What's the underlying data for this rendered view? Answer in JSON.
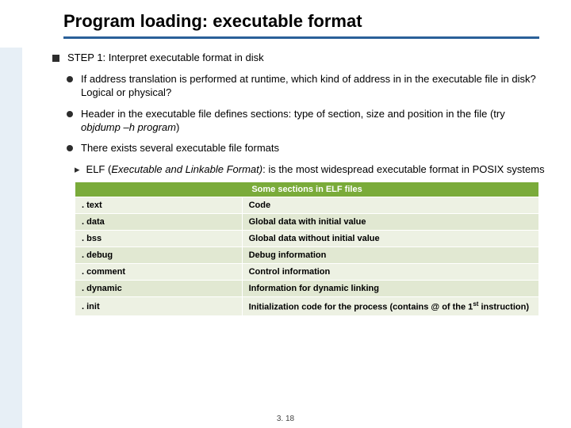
{
  "title": "Program loading: executable format",
  "step1": "STEP 1: Interpret executable format in disk",
  "bullets": {
    "b1": "If address translation is performed at runtime, which kind of address in in the executable file in disk? Logical or physical?",
    "b2_pre": "Header in the executable file defines sections: type of section, size and position in the file (try ",
    "b2_em": "objdump –h program",
    "b2_post": ")",
    "b3": "There exists several executable file formats",
    "b3a_pre": "ELF (",
    "b3a_em": "Executable and Linkable Format)",
    "b3a_post": ": is the most widespread executable format in POSIX systems"
  },
  "table": {
    "header": "Some sections in ELF files",
    "rows": [
      {
        "k": ". text",
        "v": "Code"
      },
      {
        "k": ". data",
        "v": "Global data with initial value"
      },
      {
        "k": ". bss",
        "v": "Global data without initial value"
      },
      {
        "k": ". debug",
        "v": "Debug information"
      },
      {
        "k": ". comment",
        "v": "Control information"
      },
      {
        "k": ". dynamic",
        "v": "Information for dynamic linking"
      }
    ],
    "last_k": ". init",
    "last_v_pre": "Initialization code for the process (contains @ of the 1",
    "last_v_sup": "st",
    "last_v_post": " instruction)"
  },
  "footer": "3. 18"
}
